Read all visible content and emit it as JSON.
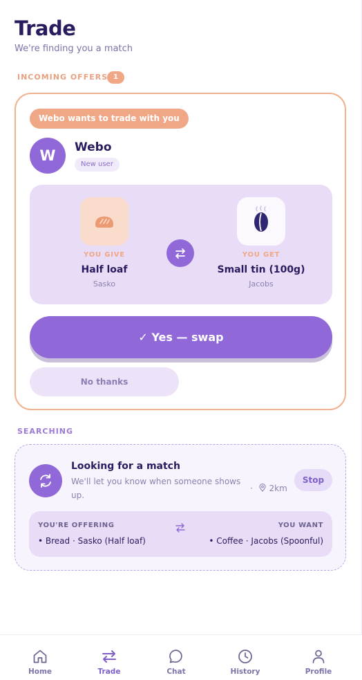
{
  "header": {
    "title": "Trade",
    "subtitle": "We're finding you a match"
  },
  "incoming": {
    "label": "INCOMING OFFERS",
    "count": "1",
    "offer": {
      "banner": "Webo wants to trade with you",
      "avatar_initial": "W",
      "user_name": "Webo",
      "user_badge": "New user",
      "give": {
        "caption": "YOU GIVE",
        "name": "Half loaf",
        "brand": "Sasko",
        "icon": "bread-icon"
      },
      "get": {
        "caption": "YOU GET",
        "name": "Small tin (100g)",
        "brand": "Jacobs",
        "icon": "coffee-bean-icon"
      },
      "accept_label": "✓ Yes — swap",
      "decline_label": "No thanks"
    }
  },
  "searching": {
    "label": "SEARCHING",
    "title": "Looking for a match",
    "description": "We'll let you know when someone shows up.",
    "distance": "· 2km",
    "stop_label": "Stop",
    "offering_label": "YOU'RE OFFERING",
    "offering_value": "• Bread · Sasko (Half loaf)",
    "want_label": "YOU WANT",
    "want_value": "• Coffee · Jacobs (Spoonful)"
  },
  "tabs": [
    {
      "label": "Home",
      "icon": "home-icon",
      "active": false
    },
    {
      "label": "Trade",
      "icon": "swap-arrows-icon",
      "active": true
    },
    {
      "label": "Chat",
      "icon": "chat-bubble-icon",
      "active": false
    },
    {
      "label": "History",
      "icon": "clock-icon",
      "active": false
    },
    {
      "label": "Profile",
      "icon": "person-icon",
      "active": false
    }
  ],
  "colors": {
    "accent": "#9068d8",
    "offer": "#f0a785",
    "text": "#2a1b5e",
    "panel": "#e8dcf7"
  }
}
